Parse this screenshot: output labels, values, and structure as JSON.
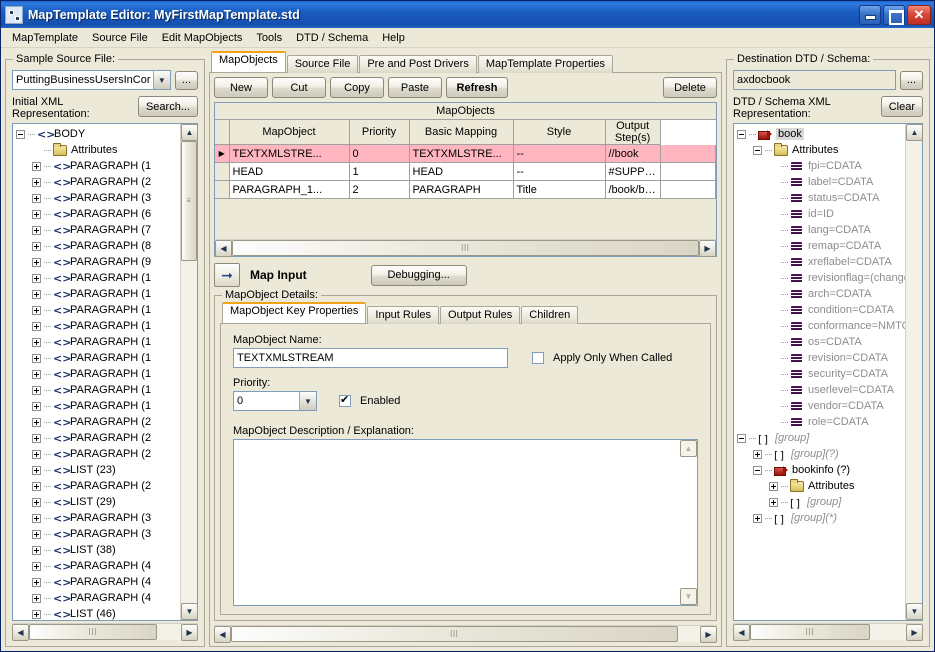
{
  "window": {
    "title": "MapTemplate Editor: MyFirstMapTemplate.std",
    "minimize_label": "Minimize",
    "maximize_label": "Maximize",
    "close_label": "Close"
  },
  "menubar": {
    "items": [
      {
        "label": "MapTemplate"
      },
      {
        "label": "Source File"
      },
      {
        "label": "Edit MapObjects"
      },
      {
        "label": "Tools"
      },
      {
        "label": "DTD / Schema"
      },
      {
        "label": "Help"
      }
    ]
  },
  "left_panel": {
    "group_title": "Sample Source File:",
    "source_file_value": "PuttingBusinessUsersInCor",
    "browse_label": "...",
    "xml_rep_label": "Initial XML\nRepresentation:",
    "xml_rep_label_line1": "Initial XML",
    "xml_rep_label_line2": "Representation:",
    "search_label": "Search...",
    "tree": [
      {
        "indent": 1,
        "toggle": "minus",
        "icon": "xml-icon",
        "label": "BODY"
      },
      {
        "indent": 2,
        "toggle": "none",
        "icon": "folder-icon",
        "label": "Attributes"
      },
      {
        "indent": 2,
        "toggle": "plus",
        "icon": "xml-icon",
        "label": "PARAGRAPH (1"
      },
      {
        "indent": 2,
        "toggle": "plus",
        "icon": "xml-icon",
        "label": "PARAGRAPH (2"
      },
      {
        "indent": 2,
        "toggle": "plus",
        "icon": "xml-icon",
        "label": "PARAGRAPH (3"
      },
      {
        "indent": 2,
        "toggle": "plus",
        "icon": "xml-icon",
        "label": "PARAGRAPH (6"
      },
      {
        "indent": 2,
        "toggle": "plus",
        "icon": "xml-icon",
        "label": "PARAGRAPH (7"
      },
      {
        "indent": 2,
        "toggle": "plus",
        "icon": "xml-icon",
        "label": "PARAGRAPH (8"
      },
      {
        "indent": 2,
        "toggle": "plus",
        "icon": "xml-icon",
        "label": "PARAGRAPH (9"
      },
      {
        "indent": 2,
        "toggle": "plus",
        "icon": "xml-icon",
        "label": "PARAGRAPH (1"
      },
      {
        "indent": 2,
        "toggle": "plus",
        "icon": "xml-icon",
        "label": "PARAGRAPH (1"
      },
      {
        "indent": 2,
        "toggle": "plus",
        "icon": "xml-icon",
        "label": "PARAGRAPH (1"
      },
      {
        "indent": 2,
        "toggle": "plus",
        "icon": "xml-icon",
        "label": "PARAGRAPH (1"
      },
      {
        "indent": 2,
        "toggle": "plus",
        "icon": "xml-icon",
        "label": "PARAGRAPH (1"
      },
      {
        "indent": 2,
        "toggle": "plus",
        "icon": "xml-icon",
        "label": "PARAGRAPH (1"
      },
      {
        "indent": 2,
        "toggle": "plus",
        "icon": "xml-icon",
        "label": "PARAGRAPH (1"
      },
      {
        "indent": 2,
        "toggle": "plus",
        "icon": "xml-icon",
        "label": "PARAGRAPH (1"
      },
      {
        "indent": 2,
        "toggle": "plus",
        "icon": "xml-icon",
        "label": "PARAGRAPH (1"
      },
      {
        "indent": 2,
        "toggle": "plus",
        "icon": "xml-icon",
        "label": "PARAGRAPH (2"
      },
      {
        "indent": 2,
        "toggle": "plus",
        "icon": "xml-icon",
        "label": "PARAGRAPH (2"
      },
      {
        "indent": 2,
        "toggle": "plus",
        "icon": "xml-icon",
        "label": "PARAGRAPH (2"
      },
      {
        "indent": 2,
        "toggle": "plus",
        "icon": "xml-icon",
        "label": "LIST (23)"
      },
      {
        "indent": 2,
        "toggle": "plus",
        "icon": "xml-icon",
        "label": "PARAGRAPH (2"
      },
      {
        "indent": 2,
        "toggle": "plus",
        "icon": "xml-icon",
        "label": "LIST (29)"
      },
      {
        "indent": 2,
        "toggle": "plus",
        "icon": "xml-icon",
        "label": "PARAGRAPH (3"
      },
      {
        "indent": 2,
        "toggle": "plus",
        "icon": "xml-icon",
        "label": "PARAGRAPH (3"
      },
      {
        "indent": 2,
        "toggle": "plus",
        "icon": "xml-icon",
        "label": "LIST (38)"
      },
      {
        "indent": 2,
        "toggle": "plus",
        "icon": "xml-icon",
        "label": "PARAGRAPH (4"
      },
      {
        "indent": 2,
        "toggle": "plus",
        "icon": "xml-icon",
        "label": "PARAGRAPH (4"
      },
      {
        "indent": 2,
        "toggle": "plus",
        "icon": "xml-icon",
        "label": "PARAGRAPH (4"
      },
      {
        "indent": 2,
        "toggle": "plus",
        "icon": "xml-icon",
        "label": "LIST (46)"
      }
    ]
  },
  "center_panel": {
    "tabs": [
      {
        "label": "MapObjects",
        "active": true
      },
      {
        "label": "Source File",
        "active": false
      },
      {
        "label": "Pre and Post Drivers",
        "active": false
      },
      {
        "label": "MapTemplate Properties",
        "active": false
      }
    ],
    "toolbar": {
      "new_label": "New",
      "cut_label": "Cut",
      "copy_label": "Copy",
      "paste_label": "Paste",
      "refresh_label": "Refresh",
      "delete_label": "Delete"
    },
    "grid": {
      "caption": "MapObjects",
      "columns": [
        "MapObject",
        "Priority",
        "Basic Mapping",
        "Style",
        "Output Step(s)"
      ],
      "rows": [
        {
          "selected": true,
          "marker": "▶",
          "cells": [
            "TEXTXMLSTRE...",
            "0",
            "TEXTXMLSTRE...",
            "--",
            "//book"
          ]
        },
        {
          "selected": false,
          "marker": "",
          "cells": [
            "HEAD",
            "1",
            "HEAD",
            "--",
            "#SUPPRESSED#"
          ]
        },
        {
          "selected": false,
          "marker": "",
          "cells": [
            "PARAGRAPH_1...",
            "2",
            "PARAGRAPH",
            "Title",
            "/book/bookinfo/tit..."
          ]
        }
      ]
    },
    "map_input_label": "Map Input",
    "debugging_label": "Debugging...",
    "details_group_title": "MapObject Details:",
    "detail_tabs": [
      {
        "label": "MapObject Key Properties",
        "active": true
      },
      {
        "label": "Input Rules",
        "active": false
      },
      {
        "label": "Output Rules",
        "active": false
      },
      {
        "label": "Children",
        "active": false
      }
    ],
    "details": {
      "name_label": "MapObject Name:",
      "name_value": "TEXTXMLSTREAM",
      "apply_only_when_called_label": "Apply Only When Called",
      "apply_only_when_called_checked": false,
      "priority_label": "Priority:",
      "priority_value": "0",
      "enabled_label": "Enabled",
      "enabled_checked": true,
      "description_label": "MapObject Description / Explanation:",
      "description_value": ""
    }
  },
  "right_panel": {
    "group_title": "Destination DTD / Schema:",
    "schema_value": "axdocbook",
    "browse_label": "...",
    "dtd_rep_label_line1": "DTD / Schema XML",
    "dtd_rep_label_line2": "Representation:",
    "clear_label": "Clear",
    "tree": [
      {
        "indent": 1,
        "toggle": "minus",
        "icon": "element-icon",
        "label": "book",
        "style": "selected"
      },
      {
        "indent": 2,
        "toggle": "minus",
        "icon": "folder-icon",
        "label": "Attributes",
        "style": "normal"
      },
      {
        "indent": 3,
        "toggle": "none",
        "icon": "attribute-icon",
        "label": "fpi=CDATA",
        "style": "gray"
      },
      {
        "indent": 3,
        "toggle": "none",
        "icon": "attribute-icon",
        "label": "label=CDATA",
        "style": "gray"
      },
      {
        "indent": 3,
        "toggle": "none",
        "icon": "attribute-icon",
        "label": "status=CDATA",
        "style": "gray"
      },
      {
        "indent": 3,
        "toggle": "none",
        "icon": "attribute-icon",
        "label": "id=ID",
        "style": "gray"
      },
      {
        "indent": 3,
        "toggle": "none",
        "icon": "attribute-icon",
        "label": "lang=CDATA",
        "style": "gray"
      },
      {
        "indent": 3,
        "toggle": "none",
        "icon": "attribute-icon",
        "label": "remap=CDATA",
        "style": "gray"
      },
      {
        "indent": 3,
        "toggle": "none",
        "icon": "attribute-icon",
        "label": "xreflabel=CDATA",
        "style": "gray"
      },
      {
        "indent": 3,
        "toggle": "none",
        "icon": "attribute-icon",
        "label": "revisionflag=(changed|",
        "style": "gray"
      },
      {
        "indent": 3,
        "toggle": "none",
        "icon": "attribute-icon",
        "label": "arch=CDATA",
        "style": "gray"
      },
      {
        "indent": 3,
        "toggle": "none",
        "icon": "attribute-icon",
        "label": "condition=CDATA",
        "style": "gray"
      },
      {
        "indent": 3,
        "toggle": "none",
        "icon": "attribute-icon",
        "label": "conformance=NMTOK",
        "style": "gray"
      },
      {
        "indent": 3,
        "toggle": "none",
        "icon": "attribute-icon",
        "label": "os=CDATA",
        "style": "gray"
      },
      {
        "indent": 3,
        "toggle": "none",
        "icon": "attribute-icon",
        "label": "revision=CDATA",
        "style": "gray"
      },
      {
        "indent": 3,
        "toggle": "none",
        "icon": "attribute-icon",
        "label": "security=CDATA",
        "style": "gray"
      },
      {
        "indent": 3,
        "toggle": "none",
        "icon": "attribute-icon",
        "label": "userlevel=CDATA",
        "style": "gray"
      },
      {
        "indent": 3,
        "toggle": "none",
        "icon": "attribute-icon",
        "label": "vendor=CDATA",
        "style": "gray"
      },
      {
        "indent": 3,
        "toggle": "none",
        "icon": "attribute-icon",
        "label": "role=CDATA",
        "style": "gray"
      },
      {
        "indent": 1,
        "toggle": "minus",
        "icon": "group-icon",
        "label": "[group]",
        "style": "italic"
      },
      {
        "indent": 2,
        "toggle": "plus",
        "icon": "group-icon",
        "label": "[group](?)",
        "style": "italic"
      },
      {
        "indent": 2,
        "toggle": "minus",
        "icon": "element-icon",
        "label": "bookinfo (?)",
        "style": "normal"
      },
      {
        "indent": 3,
        "toggle": "plus",
        "icon": "folder-icon",
        "label": "Attributes",
        "style": "normal"
      },
      {
        "indent": 3,
        "toggle": "plus",
        "icon": "group-icon",
        "label": "[group]",
        "style": "italic"
      },
      {
        "indent": 2,
        "toggle": "plus",
        "icon": "group-icon",
        "label": "[group](*)",
        "style": "italic"
      }
    ]
  }
}
